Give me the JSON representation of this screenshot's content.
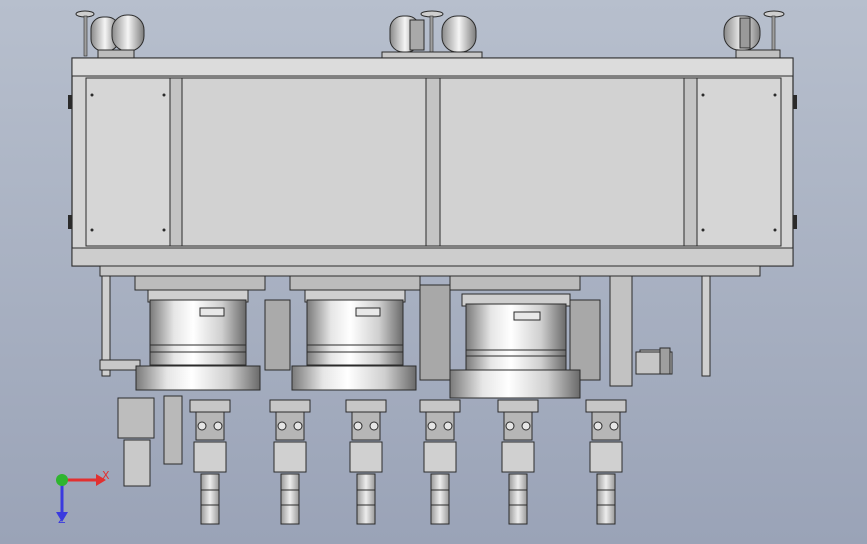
{
  "viewport": {
    "background_top": "#b7bfcd",
    "background_bottom": "#9aa3b7"
  },
  "axis_triad": {
    "x_label": "X",
    "z_label": "Z",
    "x_color": "#e23030",
    "y_color": "#2fb52f",
    "z_color": "#3a3adf"
  },
  "model": {
    "frame_color": "#d4d4d4",
    "edge_color": "#2b2b2b",
    "panel_color": "#d2d2d2",
    "cylinder_light": "#f4f4f4",
    "cylinder_dark": "#6e6e6e",
    "top_lamps": 5,
    "cylinders": 3,
    "heads": 6
  }
}
